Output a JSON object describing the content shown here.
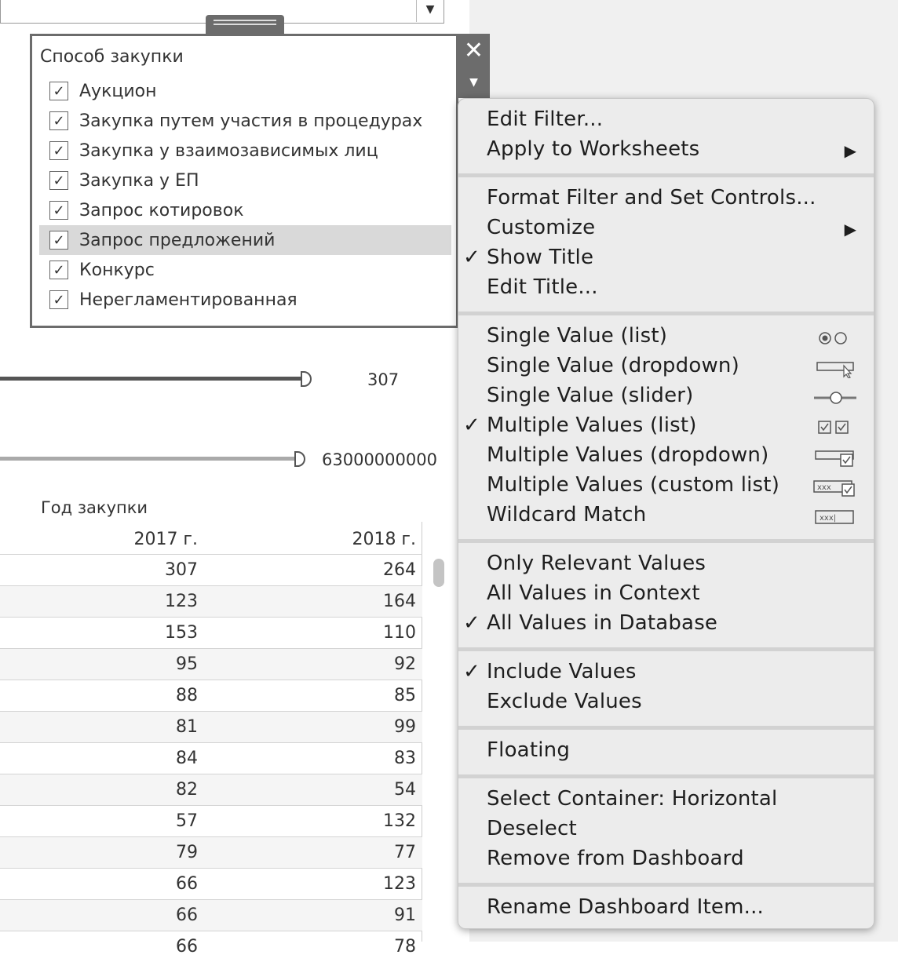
{
  "filter": {
    "title": "Способ закупки",
    "items": [
      {
        "label": "Аукцион",
        "checked": true
      },
      {
        "label": "Закупка путем участия в процедурах",
        "checked": true
      },
      {
        "label": "Закупка у взаимозависимых лиц",
        "checked": true
      },
      {
        "label": "Закупка у ЕП",
        "checked": true
      },
      {
        "label": "Запрос котировок",
        "checked": true
      },
      {
        "label": "Запрос предложений",
        "checked": true
      },
      {
        "label": "Конкурс",
        "checked": true
      },
      {
        "label": "Нерегламентированная",
        "checked": true
      }
    ],
    "close_glyph": "✕",
    "menu_glyph": "▼",
    "checkmark": "✓"
  },
  "dropdown": {
    "arrow": "▼"
  },
  "sliders": {
    "value1": "307",
    "value2": "63000000000"
  },
  "table": {
    "title": "Год закупки",
    "columns": [
      "2017 г.",
      "2018 г."
    ],
    "rows": [
      [
        "307",
        "264"
      ],
      [
        "123",
        "164"
      ],
      [
        "153",
        "110"
      ],
      [
        "95",
        "92"
      ],
      [
        "88",
        "85"
      ],
      [
        "81",
        "99"
      ],
      [
        "84",
        "83"
      ],
      [
        "82",
        "54"
      ],
      [
        "57",
        "132"
      ],
      [
        "79",
        "77"
      ],
      [
        "66",
        "123"
      ],
      [
        "66",
        "91"
      ],
      [
        "66",
        "78"
      ]
    ]
  },
  "menu": {
    "check_glyph": "✓",
    "arrow_glyph": "▶",
    "items": {
      "edit_filter": "Edit Filter...",
      "apply_to_worksheets": "Apply to Worksheets",
      "format_filter": "Format Filter and Set Controls...",
      "customize": "Customize",
      "show_title": "Show Title",
      "edit_title": "Edit Title...",
      "single_list": "Single Value (list)",
      "single_dropdown": "Single Value (dropdown)",
      "single_slider": "Single Value (slider)",
      "multiple_list": "Multiple Values (list)",
      "multiple_dropdown": "Multiple Values (dropdown)",
      "multiple_custom": "Multiple Values (custom list)",
      "wildcard": "Wildcard Match",
      "only_relevant": "Only Relevant Values",
      "all_in_context": "All Values in Context",
      "all_in_database": "All Values in Database",
      "include": "Include Values",
      "exclude": "Exclude Values",
      "floating": "Floating",
      "select_container": "Select Container: Horizontal",
      "deselect": "Deselect",
      "remove": "Remove from Dashboard",
      "rename": "Rename Dashboard Item..."
    }
  }
}
